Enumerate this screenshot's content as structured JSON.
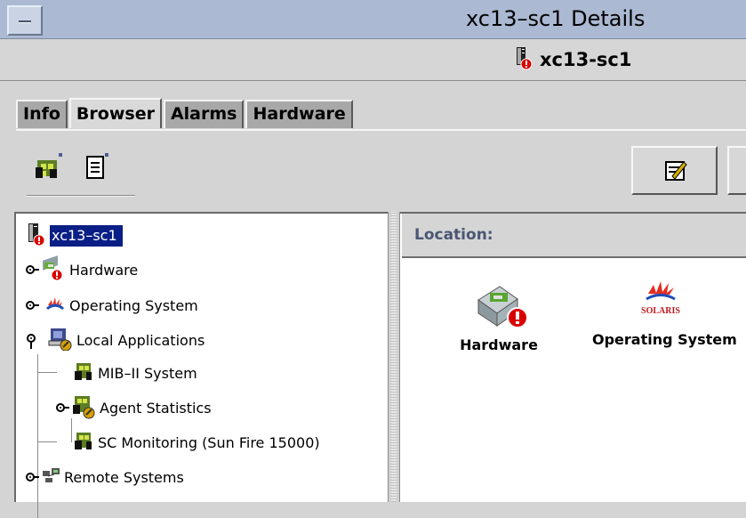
{
  "window": {
    "title": "xc13–sc1 Details",
    "host_label": "xc13-sc1"
  },
  "tabs": [
    {
      "label": "Info"
    },
    {
      "label": "Browser"
    },
    {
      "label": "Alarms"
    },
    {
      "label": "Hardware"
    }
  ],
  "tree": {
    "root": {
      "label": "xc13–sc1"
    },
    "items": [
      {
        "label": "Hardware"
      },
      {
        "label": "Operating System"
      },
      {
        "label": "Local Applications"
      },
      {
        "label": "MIB–II System"
      },
      {
        "label": "Agent Statistics"
      },
      {
        "label": "SC Monitoring (Sun Fire 15000)"
      },
      {
        "label": "Remote Systems"
      }
    ]
  },
  "content": {
    "location_label": "Location:",
    "items": [
      {
        "label": "Hardware"
      },
      {
        "label": "Operating System",
        "logo_text": "SOLARIS"
      }
    ]
  },
  "colors": {
    "titlebar": "#abb9d2",
    "selection": "#0a1f86",
    "alarm": "#d90000"
  }
}
